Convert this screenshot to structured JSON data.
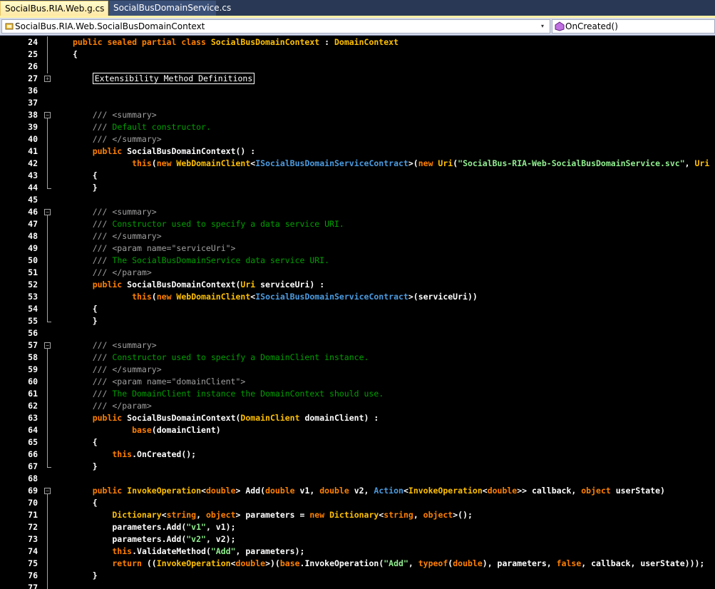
{
  "tabs": [
    {
      "label": "SocialBus.RIA.Web.g.cs",
      "active": true
    },
    {
      "label": "SocialBusDomainService.cs",
      "active": false
    }
  ],
  "nav": {
    "type_dropdown": "SocialBus.RIA.Web.SocialBusDomainContext",
    "member_dropdown": "OnCreated()"
  },
  "lines": [
    {
      "n": "24",
      "fold": "",
      "parts": [
        [
          "kw",
          "public sealed partial class "
        ],
        [
          "ty",
          "SocialBusDomainContext"
        ],
        [
          "pl",
          " : "
        ],
        [
          "ty",
          "DomainContext"
        ]
      ]
    },
    {
      "n": "25",
      "fold": "",
      "parts": [
        [
          "pl",
          "{"
        ]
      ]
    },
    {
      "n": "26",
      "fold": "",
      "parts": []
    },
    {
      "n": "27",
      "fold": "plus",
      "parts": [
        [
          "pl",
          "    "
        ],
        [
          "region",
          "Extensibility Method Definitions"
        ]
      ]
    },
    {
      "n": "36",
      "fold": "",
      "parts": []
    },
    {
      "n": "37",
      "fold": "",
      "parts": []
    },
    {
      "n": "38",
      "fold": "minus",
      "parts": [
        [
          "dc",
          "    /// <summary>"
        ]
      ]
    },
    {
      "n": "39",
      "fold": "",
      "parts": [
        [
          "dc",
          "    /// "
        ],
        [
          "cm",
          "Default constructor."
        ]
      ]
    },
    {
      "n": "40",
      "fold": "",
      "parts": [
        [
          "dc",
          "    /// </summary>"
        ]
      ]
    },
    {
      "n": "41",
      "fold": "",
      "parts": [
        [
          "kw",
          "    public "
        ],
        [
          "pl",
          "SocialBusDomainContext() :"
        ]
      ]
    },
    {
      "n": "42",
      "fold": "",
      "parts": [
        [
          "kw",
          "            this"
        ],
        [
          "pl",
          "("
        ],
        [
          "kw",
          "new "
        ],
        [
          "ty",
          "WebDomainClient"
        ],
        [
          "pl",
          "<"
        ],
        [
          "in",
          "ISocialBusDomainServiceContract"
        ],
        [
          "pl",
          ">("
        ],
        [
          "kw",
          "new "
        ],
        [
          "ty",
          "Uri"
        ],
        [
          "pl",
          "("
        ],
        [
          "st",
          "\"SocialBus-RIA-Web-SocialBusDomainService.svc\""
        ],
        [
          "pl",
          ", "
        ],
        [
          "ty",
          "Uri"
        ]
      ]
    },
    {
      "n": "43",
      "fold": "",
      "parts": [
        [
          "pl",
          "    {"
        ]
      ]
    },
    {
      "n": "44",
      "fold": "",
      "parts": [
        [
          "pl",
          "    }"
        ]
      ]
    },
    {
      "n": "45",
      "fold": "",
      "parts": []
    },
    {
      "n": "46",
      "fold": "minus",
      "parts": [
        [
          "dc",
          "    /// <summary>"
        ]
      ]
    },
    {
      "n": "47",
      "fold": "",
      "parts": [
        [
          "dc",
          "    /// "
        ],
        [
          "cm",
          "Constructor used to specify a data service URI."
        ]
      ]
    },
    {
      "n": "48",
      "fold": "",
      "parts": [
        [
          "dc",
          "    /// </summary>"
        ]
      ]
    },
    {
      "n": "49",
      "fold": "",
      "parts": [
        [
          "dc",
          "    /// <param name=\"serviceUri\">"
        ]
      ]
    },
    {
      "n": "50",
      "fold": "",
      "parts": [
        [
          "dc",
          "    /// "
        ],
        [
          "cm",
          "The SocialBusDomainService data service URI."
        ]
      ]
    },
    {
      "n": "51",
      "fold": "",
      "parts": [
        [
          "dc",
          "    /// </param>"
        ]
      ]
    },
    {
      "n": "52",
      "fold": "",
      "parts": [
        [
          "kw",
          "    public "
        ],
        [
          "pl",
          "SocialBusDomainContext("
        ],
        [
          "ty",
          "Uri"
        ],
        [
          "pl",
          " serviceUri) :"
        ]
      ]
    },
    {
      "n": "53",
      "fold": "",
      "parts": [
        [
          "kw",
          "            this"
        ],
        [
          "pl",
          "("
        ],
        [
          "kw",
          "new "
        ],
        [
          "ty",
          "WebDomainClient"
        ],
        [
          "pl",
          "<"
        ],
        [
          "in",
          "ISocialBusDomainServiceContract"
        ],
        [
          "pl",
          ">(serviceUri))"
        ]
      ]
    },
    {
      "n": "54",
      "fold": "",
      "parts": [
        [
          "pl",
          "    {"
        ]
      ]
    },
    {
      "n": "55",
      "fold": "",
      "parts": [
        [
          "pl",
          "    }"
        ]
      ]
    },
    {
      "n": "56",
      "fold": "",
      "parts": []
    },
    {
      "n": "57",
      "fold": "minus",
      "parts": [
        [
          "dc",
          "    /// <summary>"
        ]
      ]
    },
    {
      "n": "58",
      "fold": "",
      "parts": [
        [
          "dc",
          "    /// "
        ],
        [
          "cm",
          "Constructor used to specify a DomainClient instance."
        ]
      ]
    },
    {
      "n": "59",
      "fold": "",
      "parts": [
        [
          "dc",
          "    /// </summary>"
        ]
      ]
    },
    {
      "n": "60",
      "fold": "",
      "parts": [
        [
          "dc",
          "    /// <param name=\"domainClient\">"
        ]
      ]
    },
    {
      "n": "61",
      "fold": "",
      "parts": [
        [
          "dc",
          "    /// "
        ],
        [
          "cm",
          "The DomainClient instance the DomainContext should use."
        ]
      ]
    },
    {
      "n": "62",
      "fold": "",
      "parts": [
        [
          "dc",
          "    /// </param>"
        ]
      ]
    },
    {
      "n": "63",
      "fold": "",
      "parts": [
        [
          "kw",
          "    public "
        ],
        [
          "pl",
          "SocialBusDomainContext("
        ],
        [
          "ty",
          "DomainClient"
        ],
        [
          "pl",
          " domainClient) :"
        ]
      ]
    },
    {
      "n": "64",
      "fold": "",
      "parts": [
        [
          "kw",
          "            base"
        ],
        [
          "pl",
          "(domainClient)"
        ]
      ]
    },
    {
      "n": "65",
      "fold": "",
      "parts": [
        [
          "pl",
          "    {"
        ]
      ]
    },
    {
      "n": "66",
      "fold": "",
      "parts": [
        [
          "kw",
          "        this"
        ],
        [
          "pl",
          ".OnCreated();"
        ]
      ]
    },
    {
      "n": "67",
      "fold": "",
      "parts": [
        [
          "pl",
          "    }"
        ]
      ]
    },
    {
      "n": "68",
      "fold": "",
      "parts": []
    },
    {
      "n": "69",
      "fold": "minus",
      "parts": [
        [
          "kw",
          "    public "
        ],
        [
          "ty",
          "InvokeOperation"
        ],
        [
          "pl",
          "<"
        ],
        [
          "kw",
          "double"
        ],
        [
          "pl",
          "> Add("
        ],
        [
          "kw",
          "double"
        ],
        [
          "pl",
          " v1, "
        ],
        [
          "kw",
          "double"
        ],
        [
          "pl",
          " v2, "
        ],
        [
          "in",
          "Action"
        ],
        [
          "pl",
          "<"
        ],
        [
          "ty",
          "InvokeOperation"
        ],
        [
          "pl",
          "<"
        ],
        [
          "kw",
          "double"
        ],
        [
          "pl",
          ">> callback, "
        ],
        [
          "kw",
          "object"
        ],
        [
          "pl",
          " userState)"
        ]
      ]
    },
    {
      "n": "70",
      "fold": "",
      "parts": [
        [
          "pl",
          "    {"
        ]
      ]
    },
    {
      "n": "71",
      "fold": "",
      "parts": [
        [
          "ty",
          "        Dictionary"
        ],
        [
          "pl",
          "<"
        ],
        [
          "kw",
          "string"
        ],
        [
          "pl",
          ", "
        ],
        [
          "kw",
          "object"
        ],
        [
          "pl",
          "> parameters = "
        ],
        [
          "kw",
          "new "
        ],
        [
          "ty",
          "Dictionary"
        ],
        [
          "pl",
          "<"
        ],
        [
          "kw",
          "string"
        ],
        [
          "pl",
          ", "
        ],
        [
          "kw",
          "object"
        ],
        [
          "pl",
          ">();"
        ]
      ]
    },
    {
      "n": "72",
      "fold": "",
      "parts": [
        [
          "pl",
          "        parameters.Add("
        ],
        [
          "st",
          "\"v1\""
        ],
        [
          "pl",
          ", v1);"
        ]
      ]
    },
    {
      "n": "73",
      "fold": "",
      "parts": [
        [
          "pl",
          "        parameters.Add("
        ],
        [
          "st",
          "\"v2\""
        ],
        [
          "pl",
          ", v2);"
        ]
      ]
    },
    {
      "n": "74",
      "fold": "",
      "parts": [
        [
          "kw",
          "        this"
        ],
        [
          "pl",
          ".ValidateMethod("
        ],
        [
          "st",
          "\"Add\""
        ],
        [
          "pl",
          ", parameters);"
        ]
      ]
    },
    {
      "n": "75",
      "fold": "",
      "parts": [
        [
          "kw",
          "        return "
        ],
        [
          "pl",
          "(("
        ],
        [
          "ty",
          "InvokeOperation"
        ],
        [
          "pl",
          "<"
        ],
        [
          "kw",
          "double"
        ],
        [
          "pl",
          ">)("
        ],
        [
          "kw",
          "base"
        ],
        [
          "pl",
          ".InvokeOperation("
        ],
        [
          "st",
          "\"Add\""
        ],
        [
          "pl",
          ", "
        ],
        [
          "kw",
          "typeof"
        ],
        [
          "pl",
          "("
        ],
        [
          "kw",
          "double"
        ],
        [
          "pl",
          "), parameters, "
        ],
        [
          "kw",
          "false"
        ],
        [
          "pl",
          ", callback, userState)));"
        ]
      ]
    },
    {
      "n": "76",
      "fold": "",
      "parts": [
        [
          "pl",
          "    }"
        ]
      ]
    },
    {
      "n": "77",
      "fold": "",
      "parts": []
    }
  ]
}
